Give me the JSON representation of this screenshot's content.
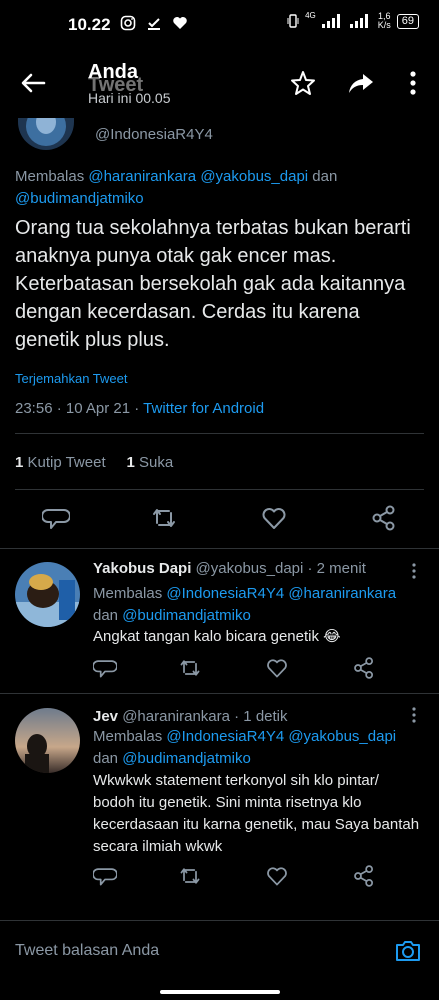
{
  "status_bar": {
    "time": "10.22",
    "network": "4G",
    "speed_top": "1,6",
    "speed_unit": "K/s",
    "battery": "69"
  },
  "header": {
    "title": "Anda",
    "ghost_title": "Tweet",
    "subtitle": "Hari ini 00.05"
  },
  "main_tweet": {
    "handle": "@IndonesiaR4Y4",
    "reply_prefix": "Membalas ",
    "reply_users": [
      "@haranirankara",
      "@yakobus_dapi"
    ],
    "reply_and": " dan ",
    "reply_last": "@budimandjatmiko",
    "text": "Orang tua sekolahnya terbatas bukan berarti anaknya punya otak gak encer mas. Keterbatasan bersekolah gak ada kaitannya dengan kecerdasan. Cerdas itu karena genetik plus plus.",
    "translate": "Terjemahkan Tweet",
    "time": "23:56 · 10 Apr 21 · ",
    "source": "Twitter for Android",
    "quote_count": "1",
    "quote_label": " Kutip Tweet",
    "like_count": "1",
    "like_label": " Suka"
  },
  "replies": [
    {
      "name": "Yakobus Dapi",
      "handle_time": " @yakobus_dapi · 2 menit",
      "reply_prefix": "Membalas ",
      "reply_users": "@IndonesiaR4Y4 @haranirankara",
      "reply_and": "dan ",
      "reply_last": "@budimandjatmiko",
      "text": "Angkat tangan kalo bicara genetik 😂"
    },
    {
      "name": "Jev",
      "handle_time": " @haranirankara · 1 detik",
      "reply_prefix": "Membalas ",
      "reply_users": "@IndonesiaR4Y4 @yakobus_dapi",
      "reply_and": "dan ",
      "reply_last": "@budimandjatmiko",
      "text": "Wkwkwk statement terkonyol sih klo pintar/ bodoh itu genetik. Sini minta risetnya klo kecerdasaan itu karna genetik, mau Saya bantah secara ilmiah wkwk"
    }
  ],
  "compose": {
    "placeholder": "Tweet balasan Anda"
  },
  "colors": {
    "accent": "#1d9bf0",
    "muted": "#8b98a5",
    "text": "#e7e9ea",
    "divider": "#2f3336"
  }
}
